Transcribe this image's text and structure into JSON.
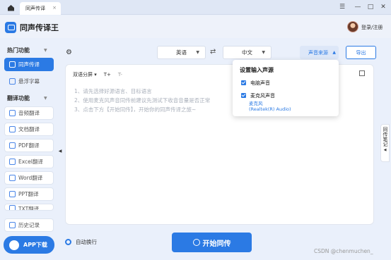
{
  "titlebar": {
    "tab_label": "同声传译",
    "tab_close": "×"
  },
  "window_controls": {
    "menu": "☰",
    "minimize": "—",
    "maximize": "□",
    "close": "✕"
  },
  "header": {
    "app_title": "同声传译王",
    "login_label": "登录/注册"
  },
  "sidebar": {
    "hot_section": "热门功能",
    "hot_items": [
      "同声传译",
      "悬浮字幕"
    ],
    "translate_section": "翻译功能",
    "translate_items": [
      "音频翻译",
      "文档翻译",
      "PDF翻译",
      "Excel翻译",
      "Word翻译",
      "PPT翻译",
      "TXT翻译"
    ],
    "history": "历史记录",
    "app_download": "APP下载"
  },
  "main": {
    "source_lang": "英语",
    "target_lang": "中文",
    "audio_source_btn": "声音来源",
    "export_btn": "导出",
    "view_mode": "双语分屏",
    "font_up": "T+",
    "font_down": "T-",
    "tips": [
      "1、请先选择好源语言、目标语言",
      "2、使用麦克风声音同传前建议先测试下收音音量是否正常",
      "3、点击下方【开始同传】，开始你的同声传译之旅~"
    ]
  },
  "dropdown": {
    "title": "设置输入声源",
    "options": [
      "电脑声音",
      "麦克风声音"
    ],
    "mic_name": "麦克风",
    "mic_device": "(Realtek(R) Audio)"
  },
  "notes_tab": "同传笔记",
  "bottom": {
    "auto_wrap": "自动换行",
    "start_btn": "开始同传"
  },
  "watermark": "CSDN @chenmuchen_",
  "colors": {
    "accent": "#2b7ae4",
    "background": "#eaf0fb"
  }
}
